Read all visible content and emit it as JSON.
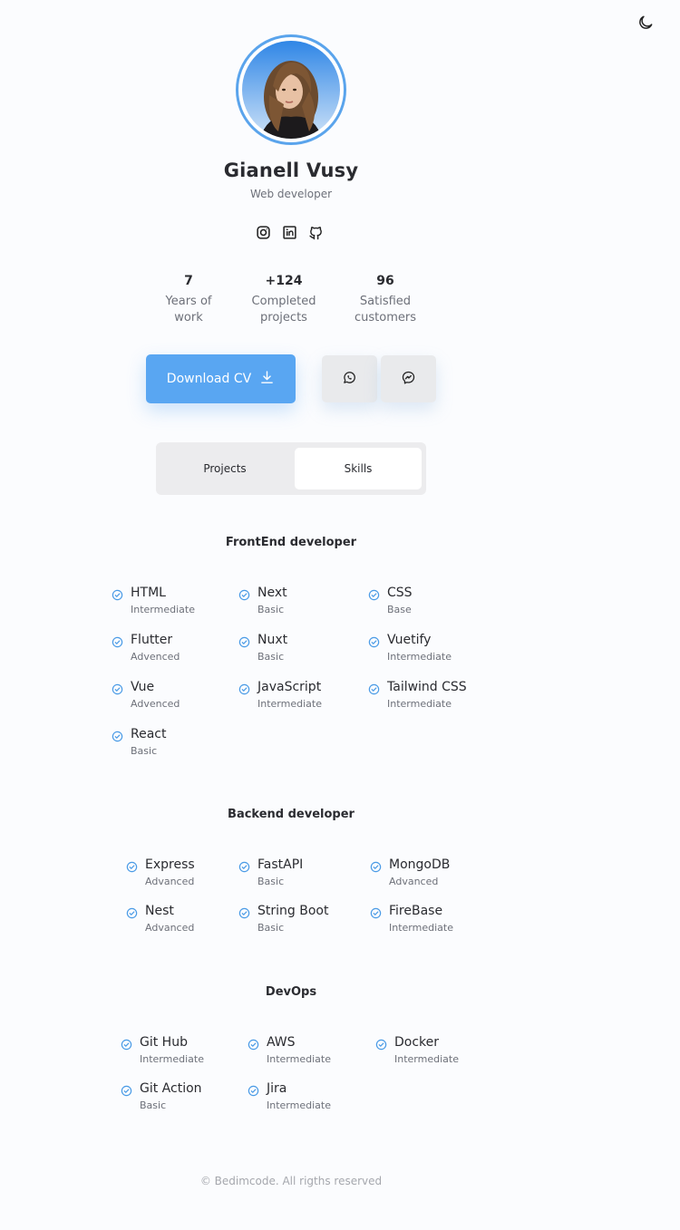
{
  "header": {
    "theme_icon": "moon-icon"
  },
  "profile": {
    "name": "Gianell Vusy",
    "role": "Web developer",
    "socials": [
      {
        "icon": "instagram-icon"
      },
      {
        "icon": "linkedin-icon"
      },
      {
        "icon": "github-icon"
      }
    ]
  },
  "stats": [
    {
      "value": "7",
      "label": "Years of\nwork"
    },
    {
      "value": "+124",
      "label": "Completed\nprojects"
    },
    {
      "value": "96",
      "label": "Satisfied\ncustomers"
    }
  ],
  "actions": {
    "download_cv": "Download CV",
    "whatsapp_icon": "whatsapp-icon",
    "messenger_icon": "messenger-icon"
  },
  "tabs": {
    "projects": "Projects",
    "skills": "Skills",
    "active": "Skills"
  },
  "colors": {
    "accent": "#59a6f2",
    "check": "#4a9be6"
  },
  "skills": {
    "frontend": {
      "title": "FrontEnd developer",
      "items": [
        {
          "name": "HTML",
          "level": "Intermediate"
        },
        {
          "name": "Next",
          "level": "Basic"
        },
        {
          "name": "CSS",
          "level": "Base"
        },
        {
          "name": "Flutter",
          "level": "Advenced"
        },
        {
          "name": "Nuxt",
          "level": "Basic"
        },
        {
          "name": "Vuetify",
          "level": "Intermediate"
        },
        {
          "name": "Vue",
          "level": "Advenced"
        },
        {
          "name": "JavaScript",
          "level": "Intermediate"
        },
        {
          "name": "Tailwind CSS",
          "level": "Intermediate"
        },
        {
          "name": "React",
          "level": "Basic"
        }
      ]
    },
    "backend": {
      "title": "Backend developer",
      "items": [
        {
          "name": "Express",
          "level": "Advanced"
        },
        {
          "name": "FastAPI",
          "level": "Basic"
        },
        {
          "name": "MongoDB",
          "level": "Advanced"
        },
        {
          "name": "Nest",
          "level": "Advanced"
        },
        {
          "name": "String Boot",
          "level": "Basic"
        },
        {
          "name": "FireBase",
          "level": "Intermediate"
        }
      ]
    },
    "devops": {
      "title": "DevOps",
      "items": [
        {
          "name": "Git Hub",
          "level": "Intermediate"
        },
        {
          "name": "AWS",
          "level": "Intermediate"
        },
        {
          "name": "Docker",
          "level": "Intermediate"
        },
        {
          "name": "Git Action",
          "level": "Basic"
        },
        {
          "name": "Jira",
          "level": "Intermediate"
        }
      ]
    }
  },
  "footer": {
    "text": "© Bedimcode. All rigths reserved"
  }
}
